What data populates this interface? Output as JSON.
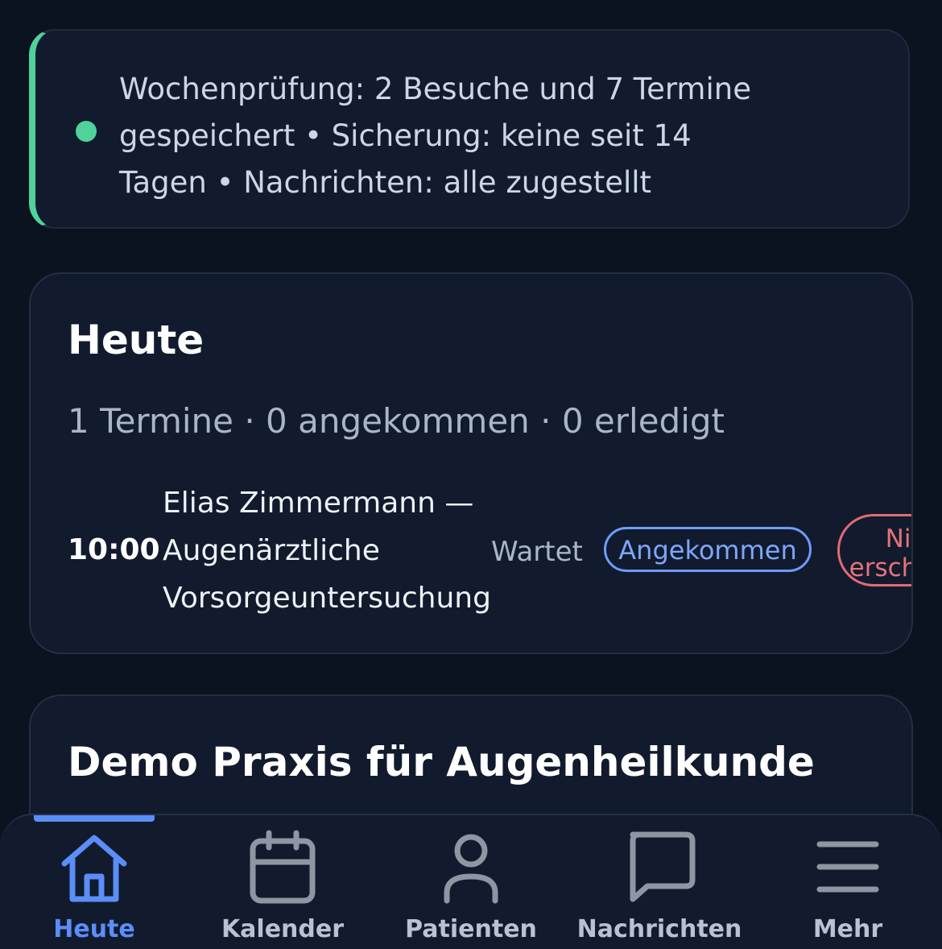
{
  "status_banner": {
    "text": "Wochenprüfung: 2 Besuche und 7 Termine gespeichert • Sicherung: keine seit 14 Tagen • Nachrichten: alle zugestellt",
    "accent_color": "#4fd39a"
  },
  "today": {
    "title": "Heute",
    "summary": "1 Termine · 0 angekommen · 0 erledigt",
    "appointments": [
      {
        "time": "10:00",
        "description": "Elias Zimmermann — Augenärztliche Vorsorgeuntersuchung",
        "status": "Wartet",
        "arrived_label": "Angekommen",
        "no_show_label": "Nicht erschienen"
      }
    ]
  },
  "practice": {
    "title": "Demo Praxis für Augenheilkunde"
  },
  "bottom_nav": {
    "active_color": "#5b8ef8",
    "items": [
      {
        "label": "Heute",
        "icon": "home-icon",
        "active": true
      },
      {
        "label": "Kalender",
        "icon": "calendar-icon",
        "active": false
      },
      {
        "label": "Patienten",
        "icon": "person-icon",
        "active": false
      },
      {
        "label": "Nachrichten",
        "icon": "chat-bubble-icon",
        "active": false
      },
      {
        "label": "Mehr",
        "icon": "menu-icon",
        "active": false
      }
    ]
  }
}
